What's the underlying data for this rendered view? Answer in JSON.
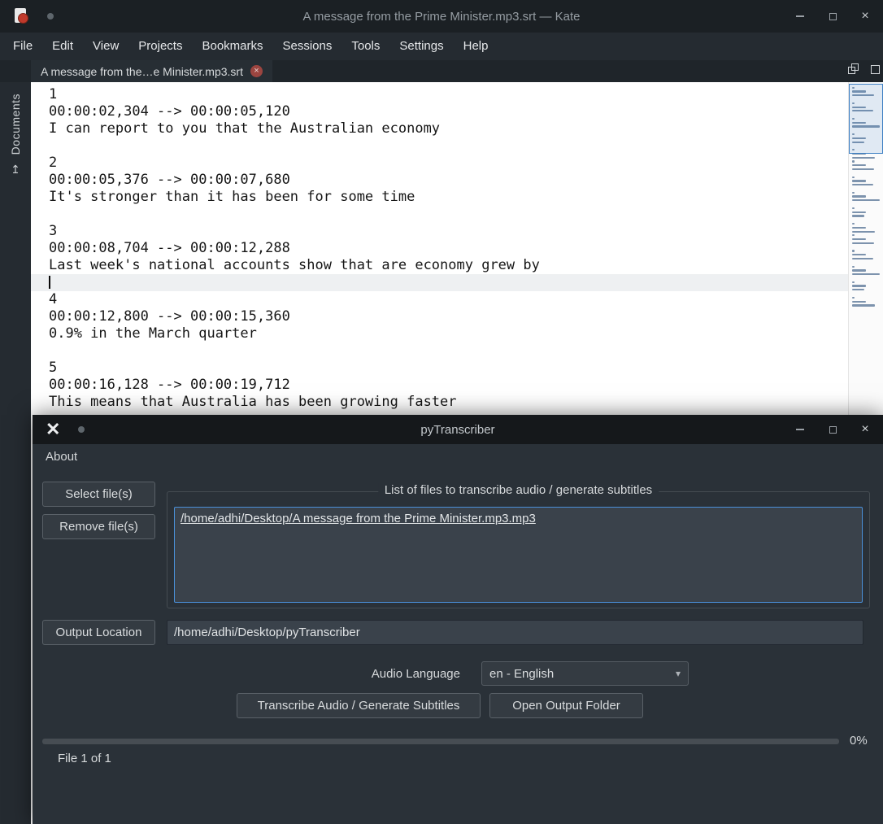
{
  "icons": {
    "close": "×",
    "tab_close": "×",
    "app_x": "✕",
    "chevron_down": "▾",
    "doc_upload": "↥"
  },
  "kate": {
    "title": "A message from the Prime Minister.mp3.srt — Kate",
    "menus": [
      "File",
      "Edit",
      "View",
      "Projects",
      "Bookmarks",
      "Sessions",
      "Tools",
      "Settings",
      "Help"
    ],
    "tab_label": "A message from the…e Minister.mp3.srt",
    "sidebar_label": "Documents",
    "cursor_line_index": 11,
    "editor_lines": [
      "1",
      "00:00:02,304 --> 00:00:05,120",
      "I can report to you that the Australian economy",
      "",
      "2",
      "00:00:05,376 --> 00:00:07,680",
      "It's stronger than it has been for some time",
      "",
      "3",
      "00:00:08,704 --> 00:00:12,288",
      "Last week's national accounts show that are economy grew by",
      "",
      "4",
      "00:00:12,800 --> 00:00:15,360",
      "0.9% in the March quarter",
      "",
      "5",
      "00:00:16,128 --> 00:00:19,712",
      "This means that Australia has been growing faster"
    ]
  },
  "pytranscriber": {
    "title": "pyTranscriber",
    "menus": [
      "About"
    ],
    "select_files_label": "Select file(s)",
    "remove_files_label": "Remove file(s)",
    "files_group_label": "List of files to transcribe audio / generate subtitles",
    "file_item": "/home/adhi/Desktop/A message from the Prime Minister.mp3.mp3",
    "output_location_label": "Output Location",
    "output_location_value": "/home/adhi/Desktop/pyTranscriber",
    "audio_language_label": "Audio Language",
    "audio_language_value": "en - English",
    "transcribe_label": "Transcribe Audio / Generate Subtitles",
    "open_output_label": "Open Output Folder",
    "progress_percent": "0%",
    "file_counter": "File 1 of 1"
  }
}
